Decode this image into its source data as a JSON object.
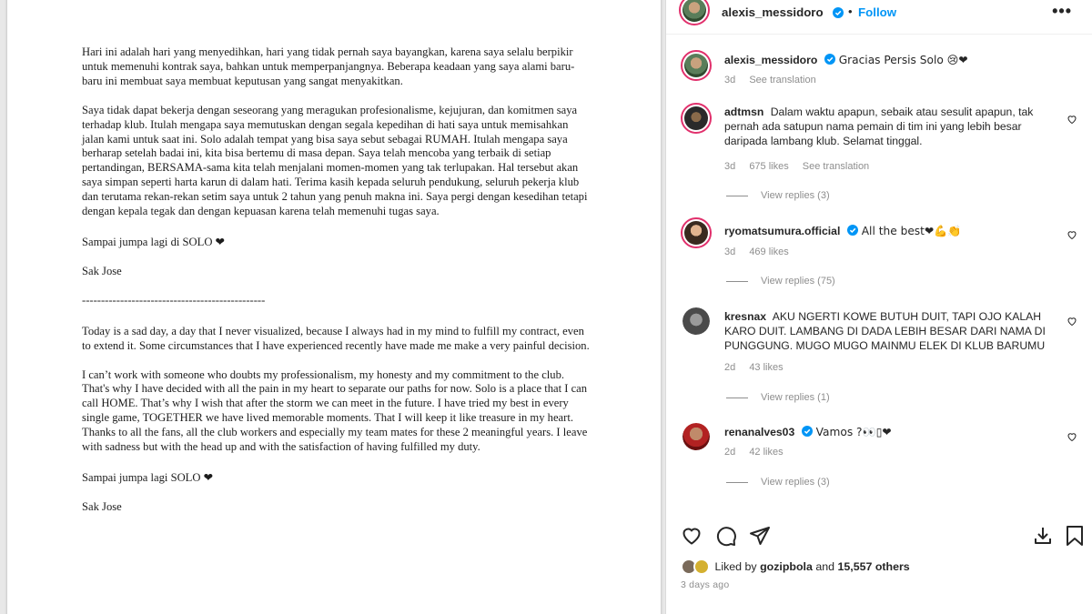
{
  "letter": {
    "p1": "Hari ini adalah hari yang menyedihkan, hari yang tidak pernah saya bayangkan, karena saya selalu berpikir untuk memenuhi kontrak saya, bahkan untuk memperpanjangnya. Beberapa keadaan yang saya alami baru-baru ini membuat saya membuat keputusan yang sangat menyakitkan.",
    "p2": "Saya tidak dapat bekerja dengan seseorang yang meragukan profesionalisme, kejujuran, dan komitmen saya terhadap klub. Itulah mengapa saya memutuskan dengan segala kepedihan di hati saya untuk memisahkan jalan kami untuk saat ini. Solo adalah tempat yang bisa saya sebut sebagai RUMAH. Itulah mengapa saya berharap setelah badai ini, kita bisa bertemu di masa depan. Saya telah mencoba yang terbaik di setiap pertandingan, BERSAMA-sama kita telah menjalani momen-momen yang tak terlupakan. Hal tersebut akan saya simpan seperti harta karun di dalam hati. Terima kasih kepada seluruh pendukung, seluruh pekerja klub dan terutama rekan-rekan setim saya untuk 2 tahun yang penuh makna ini. Saya pergi dengan kesedihan tetapi dengan kepala tegak dan dengan kepuasan karena telah memenuhi tugas saya.",
    "closing1": "Sampai jumpa lagi di SOLO ❤",
    "sign1": "Sak Jose",
    "separator": "------------------------------------------------",
    "p3": "Today is a sad day, a day that I never visualized, because I always had in my mind to fulfill my contract, even to extend it. Some circumstances that I have experienced recently have made me make a very painful decision.",
    "p4": "I can’t  work with someone who doubts my professionalism, my honesty and my commitment to the club. That's why I have decided with all the pain in my heart to separate our paths for now. Solo is a place that I can call HOME. That’s  why I wish that after the storm we can meet in the future. I have tried my best in every single game, TOGETHER  we have lived memorable moments. That I will keep it like treasure in my heart. Thanks to all the fans, all the club workers and especially my team mates  for these 2 meaningful years. I leave with sadness but with the head up and with the satisfaction of having fulfilled my duty.",
    "closing2": "Sampai jumpa lagi  SOLO ❤",
    "sign2": "Sak Jose"
  },
  "post": {
    "username": "alexis_messidoro",
    "dot": "•",
    "follow": "Follow",
    "more": "•••",
    "caption": "Gracias Persis Solo 😢❤",
    "caption_age": "3d",
    "caption_translate": "See translation"
  },
  "comments": [
    {
      "username": "adtmsn",
      "text": "Dalam waktu apapun, sebaik atau sesulit apapun, tak pernah ada satupun nama pemain di tim ini yang lebih besar daripada lambang klub. Selamat tinggal.",
      "age": "3d",
      "likes": "675 likes",
      "translate": "See translation",
      "replies": "View replies (3)"
    },
    {
      "username": "ryomatsumura.official",
      "text": "All the best❤💪👏",
      "age": "3d",
      "likes": "469 likes",
      "replies": "View replies (75)"
    },
    {
      "username": "kresnax",
      "text": "AKU NGERTI KOWE BUTUH DUIT, TAPI OJO KALAH KARO DUIT. LAMBANG DI DADA LEBIH BESAR DARI NAMA DI PUNGGUNG. MUGO MUGO MAINMU ELEK DI KLUB BARUMU",
      "age": "2d",
      "likes": "43 likes",
      "replies": "View replies (1)"
    },
    {
      "username": "renanalves03",
      "text": "Vamos ?👀▯❤",
      "age": "2d",
      "likes": "42 likes",
      "replies": "View replies (3)"
    }
  ],
  "likes": {
    "prefix": "Liked by",
    "user": "gozipbola",
    "and": "and",
    "others": "15,557 others"
  },
  "posted": "3 days ago",
  "colors": {
    "accent": "#0095f6",
    "verified": "#0095f6",
    "heart": "#ed4956",
    "muted": "#8e8e8e"
  }
}
